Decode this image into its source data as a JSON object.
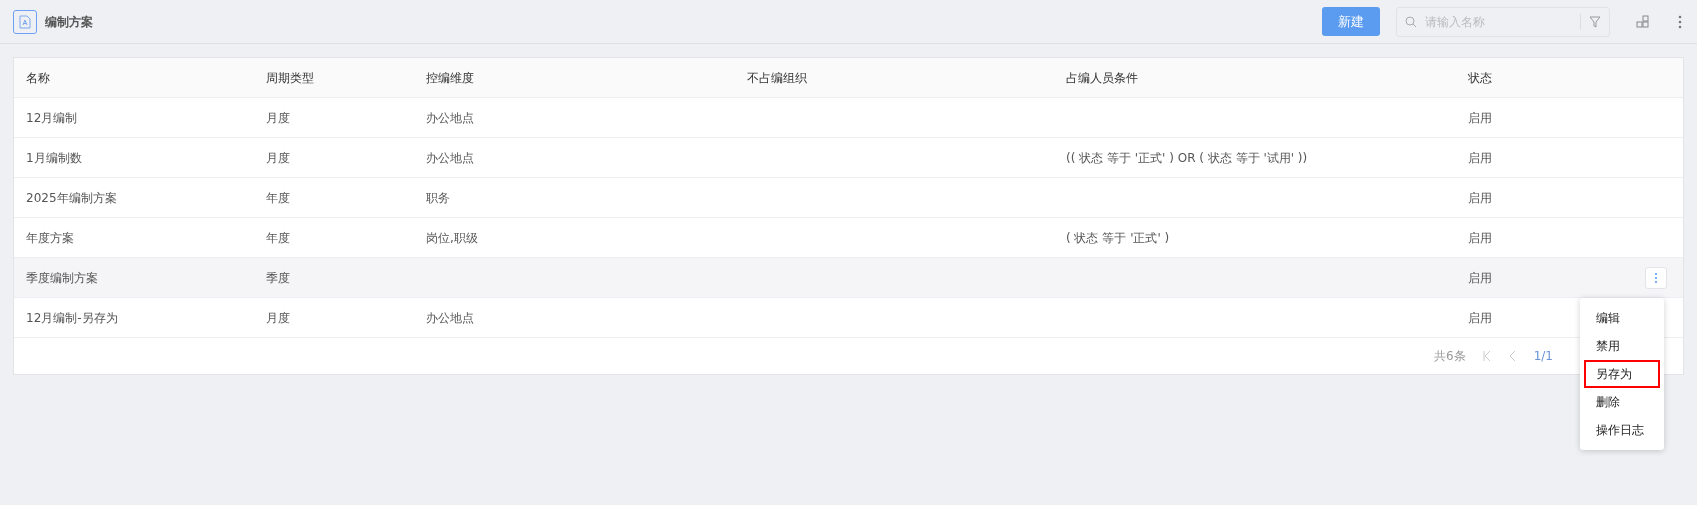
{
  "header": {
    "title": "编制方案",
    "new_button": "新建",
    "search": {
      "placeholder": "请输入名称"
    }
  },
  "table": {
    "columns": [
      "名称",
      "周期类型",
      "控编维度",
      "不占编组织",
      "占编人员条件",
      "状态"
    ],
    "rows": [
      {
        "cells": [
          "12月编制",
          "月度",
          "办公地点",
          "",
          "",
          "启用"
        ],
        "hovered": false
      },
      {
        "cells": [
          "1月编制数",
          "月度",
          "办公地点",
          "",
          "(( 状态 等于 '正式' ) OR ( 状态 等于 '试用' ))",
          "启用"
        ],
        "hovered": false
      },
      {
        "cells": [
          "2025年编制方案",
          "年度",
          "职务",
          "",
          "",
          "启用"
        ],
        "hovered": false
      },
      {
        "cells": [
          "年度方案",
          "年度",
          "岗位,职级",
          "",
          "( 状态 等于 '正式' )",
          "启用"
        ],
        "hovered": false
      },
      {
        "cells": [
          "季度编制方案",
          "季度",
          "",
          "",
          "",
          "启用"
        ],
        "hovered": true
      },
      {
        "cells": [
          "12月编制-另存为",
          "月度",
          "办公地点",
          "",
          "",
          "启用"
        ],
        "hovered": false
      }
    ]
  },
  "pagination": {
    "total": "共6条",
    "page": "1/1"
  },
  "row_menu": {
    "items": [
      {
        "label": "编辑",
        "highlighted": false
      },
      {
        "label": "禁用",
        "highlighted": false
      },
      {
        "label": "另存为",
        "highlighted": true
      },
      {
        "label": "删除",
        "highlighted": false
      },
      {
        "label": "操作日志",
        "highlighted": false
      }
    ]
  }
}
